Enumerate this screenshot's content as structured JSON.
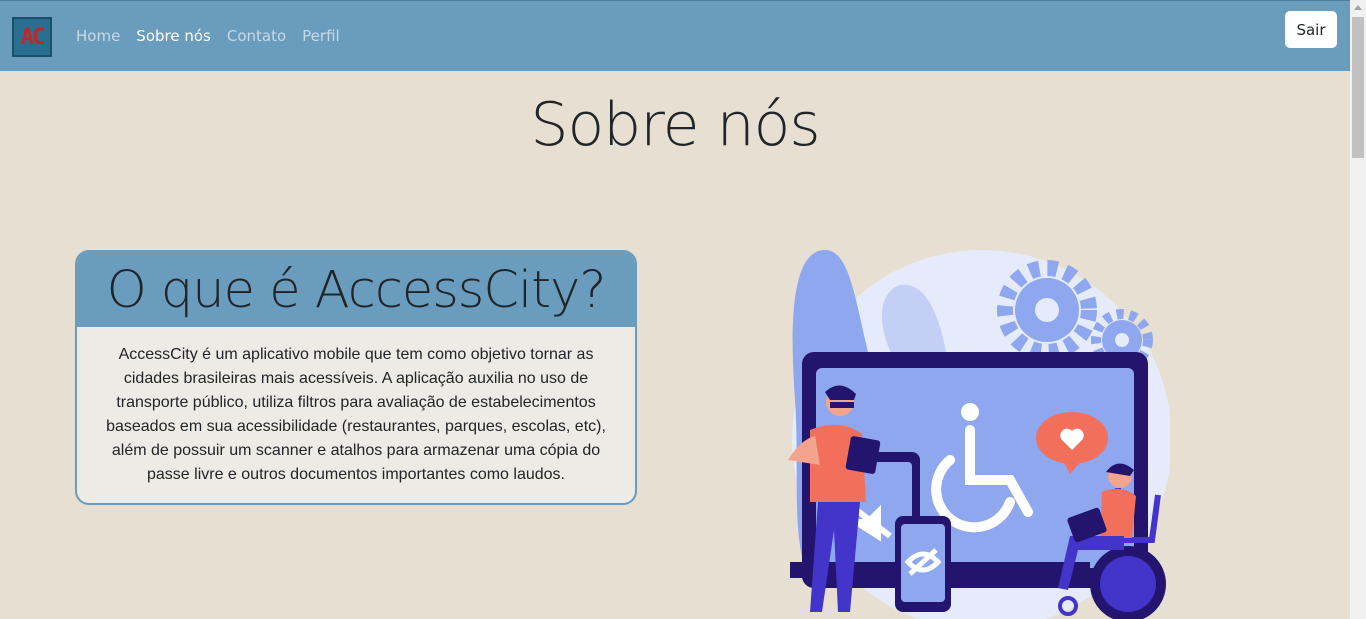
{
  "navbar": {
    "logo_text": "AC",
    "links": [
      {
        "label": "Home",
        "active": false
      },
      {
        "label": "Sobre nós",
        "active": true
      },
      {
        "label": "Contato",
        "active": false
      },
      {
        "label": "Perfil",
        "active": false
      }
    ],
    "logout_label": "Sair"
  },
  "page": {
    "title": "Sobre nós"
  },
  "card": {
    "title": "O que é AccessCity?",
    "body": "AccessCity é um aplicativo mobile que tem como objetivo tornar as cidades brasileiras mais acessíveis. A aplicação auxilia no uso de transporte público, utiliza filtros para avaliação de estabelecimentos baseados em sua acessibilidade (restaurantes, parques, escolas, etc), além de possuir um scanner e atalhos para armazenar uma cópia do passe livre e outros documentos importantes como laudos."
  },
  "colors": {
    "navbar_bg": "#6a9cbd",
    "page_bg": "#e6dfd2",
    "card_body_bg": "#edebe5",
    "illustration_primary": "#8ea7ee",
    "illustration_dark": "#23146e",
    "illustration_accent": "#f2705b"
  },
  "illustration": {
    "icon": "accessibility-illustration"
  }
}
